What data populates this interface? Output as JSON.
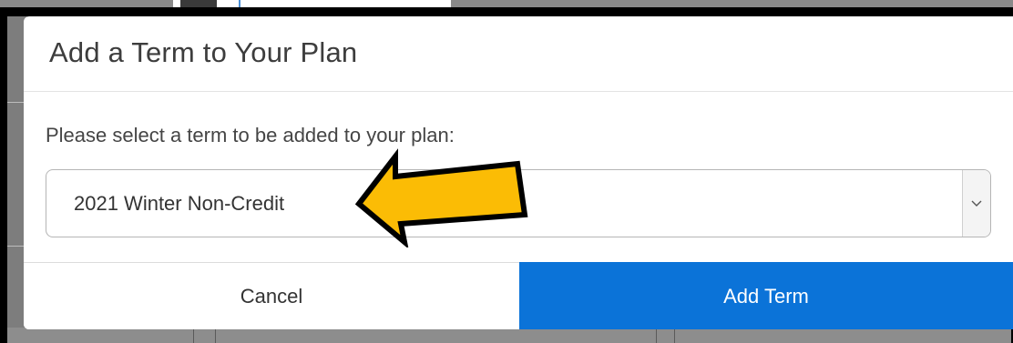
{
  "modal": {
    "title": "Add a Term to Your Plan",
    "prompt": "Please select a term to be added to your plan:",
    "term_select": {
      "selected_value": "2021 Winter Non-Credit"
    },
    "buttons": {
      "cancel_label": "Cancel",
      "add_label": "Add Term"
    }
  },
  "icons": {
    "select_caret": "chevron-down-icon",
    "annotation": "arrow-left-icon"
  },
  "colors": {
    "primary_button": "#0b73d8",
    "annotation_arrow_fill": "#fbbc05",
    "annotation_arrow_stroke": "#000000"
  }
}
